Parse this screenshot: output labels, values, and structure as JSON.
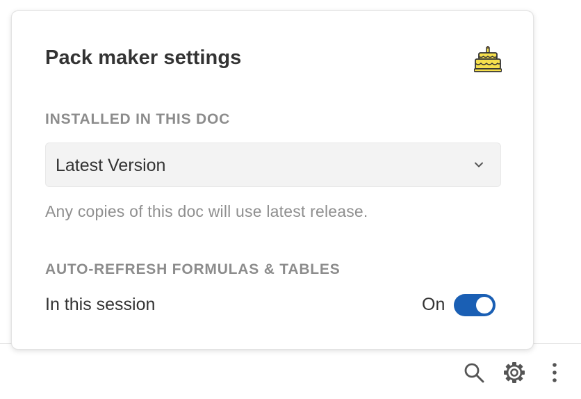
{
  "settings_panel": {
    "title": "Pack maker settings",
    "logo_icon": "layered-cake-icon",
    "installed_section": {
      "label": "INSTALLED IN THIS DOC",
      "selected_version": "Latest Version",
      "dropdown_icon": "chevron-down-icon",
      "helper_text": "Any copies of this doc will use latest release."
    },
    "refresh_section": {
      "label": "AUTO-REFRESH FORMULAS & TABLES",
      "session_label": "In this session",
      "toggle_state_label": "On",
      "toggle_on": true
    }
  },
  "toolbar": {
    "icons": [
      "search-icon",
      "gear-icon",
      "more-vertical-icon"
    ]
  },
  "colors": {
    "toggle_accent": "#1a5fb4",
    "logo_yellow": "#f5df4d",
    "logo_orange": "#f2a33a"
  }
}
